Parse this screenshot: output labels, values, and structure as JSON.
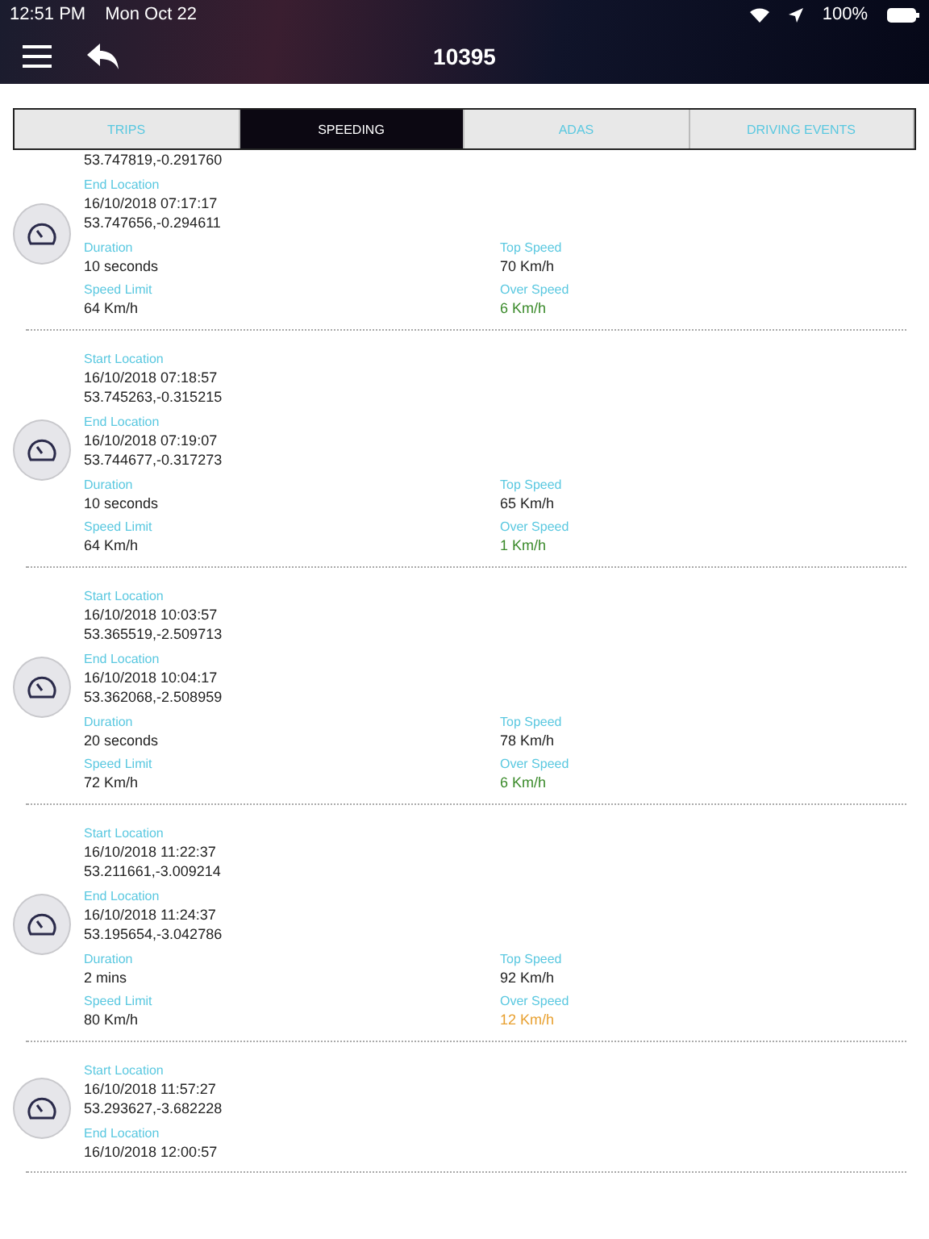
{
  "status_bar": {
    "time": "12:51 PM",
    "date": "Mon Oct 22",
    "battery": "100%"
  },
  "nav": {
    "title": "10395"
  },
  "tabs": [
    {
      "label": "TRIPS",
      "selected": false
    },
    {
      "label": "SPEEDING",
      "selected": true
    },
    {
      "label": "ADAS",
      "selected": false
    },
    {
      "label": "DRIVING EVENTS",
      "selected": false
    }
  ],
  "events": [
    {
      "locations": [
        {
          "lines": [
            "53.747819,-0.291760"
          ]
        },
        {
          "label": "End Location",
          "lines": [
            "16/10/2018 07:17:17",
            "53.747656,-0.294611"
          ]
        }
      ],
      "stats": [
        {
          "label": "Duration",
          "value": "10 seconds"
        },
        {
          "label": "Top Speed",
          "value": "70 Km/h"
        },
        {
          "label": "Speed Limit",
          "value": "64 Km/h"
        },
        {
          "label": "Over Speed",
          "value": "6 Km/h",
          "color": "#3a8a2a"
        }
      ]
    },
    {
      "locations": [
        {
          "label": "Start Location",
          "lines": [
            "16/10/2018 07:18:57",
            "53.745263,-0.315215"
          ]
        },
        {
          "label": "End Location",
          "lines": [
            "16/10/2018 07:19:07",
            "53.744677,-0.317273"
          ]
        }
      ],
      "stats": [
        {
          "label": "Duration",
          "value": "10 seconds"
        },
        {
          "label": "Top Speed",
          "value": "65 Km/h"
        },
        {
          "label": "Speed Limit",
          "value": "64 Km/h"
        },
        {
          "label": "Over Speed",
          "value": "1 Km/h",
          "color": "#3a8a2a"
        }
      ]
    },
    {
      "locations": [
        {
          "label": "Start Location",
          "lines": [
            "16/10/2018 10:03:57",
            "53.365519,-2.509713"
          ]
        },
        {
          "label": "End Location",
          "lines": [
            "16/10/2018 10:04:17",
            "53.362068,-2.508959"
          ]
        }
      ],
      "stats": [
        {
          "label": "Duration",
          "value": "20 seconds"
        },
        {
          "label": "Top Speed",
          "value": "78 Km/h"
        },
        {
          "label": "Speed Limit",
          "value": "72 Km/h"
        },
        {
          "label": "Over Speed",
          "value": "6 Km/h",
          "color": "#3a8a2a"
        }
      ]
    },
    {
      "locations": [
        {
          "label": "Start Location",
          "lines": [
            "16/10/2018 11:22:37",
            "53.211661,-3.009214"
          ]
        },
        {
          "label": "End Location",
          "lines": [
            "16/10/2018 11:24:37",
            "53.195654,-3.042786"
          ]
        }
      ],
      "stats": [
        {
          "label": "Duration",
          "value": "2 mins"
        },
        {
          "label": "Top Speed",
          "value": "92 Km/h"
        },
        {
          "label": "Speed Limit",
          "value": "80 Km/h"
        },
        {
          "label": "Over Speed",
          "value": "12 Km/h",
          "color": "#e8a030"
        }
      ]
    },
    {
      "locations": [
        {
          "label": "Start Location",
          "lines": [
            "16/10/2018 11:57:27",
            "53.293627,-3.682228"
          ]
        },
        {
          "label": "End Location",
          "lines": [
            "16/10/2018 12:00:57"
          ]
        }
      ]
    }
  ]
}
